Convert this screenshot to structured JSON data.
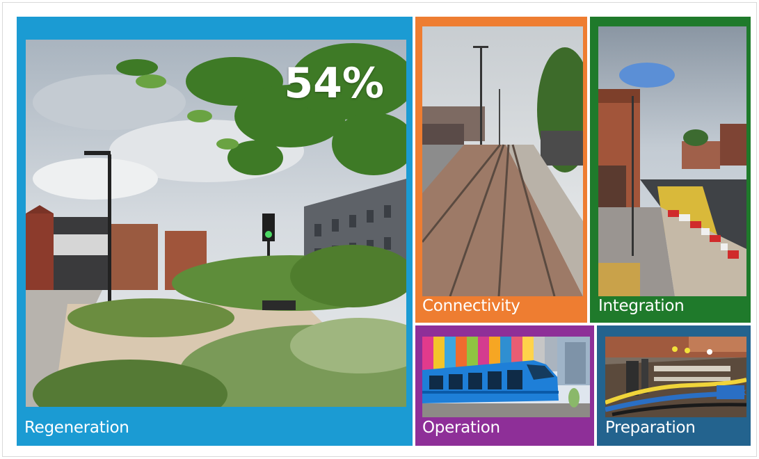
{
  "tiles": {
    "regeneration": {
      "label": "Regeneration",
      "stat": "54%",
      "color": "#1b9bd3"
    },
    "connectivity": {
      "label": "Connectivity",
      "color": "#ee7d31"
    },
    "integration": {
      "label": "Integration",
      "color": "#1f7a2b"
    },
    "operation": {
      "label": "Operation",
      "color": "#8e2f98"
    },
    "preparation": {
      "label": "Preparation",
      "color": "#23638e"
    }
  }
}
